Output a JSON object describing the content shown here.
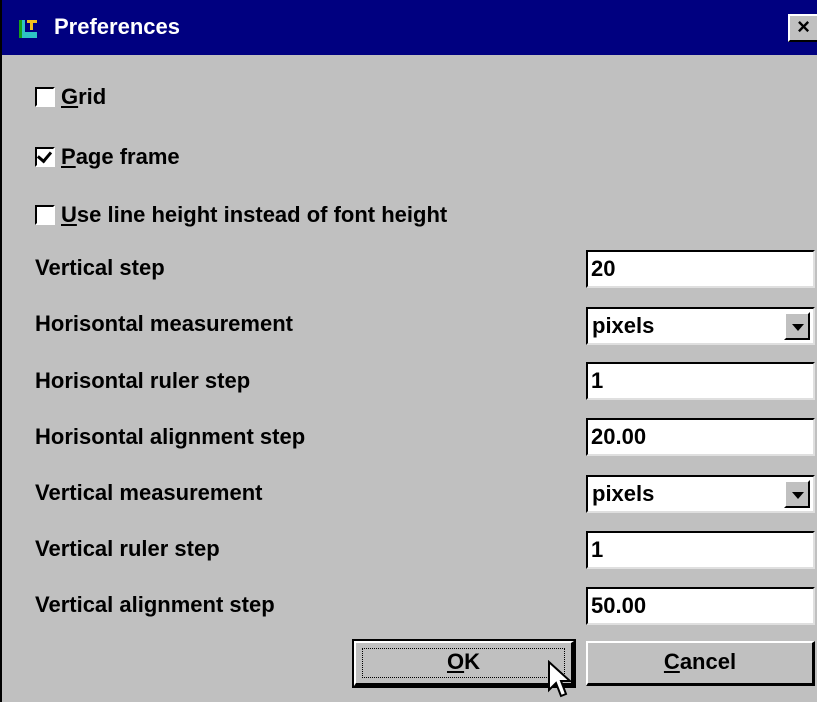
{
  "window": {
    "title": "Preferences",
    "close_glyph": "×",
    "icon": "app-logo-icon"
  },
  "checkboxes": [
    {
      "accel": "G",
      "rest": "rid",
      "checked": false
    },
    {
      "accel": "P",
      "rest": "age frame",
      "checked": true
    },
    {
      "accel": "U",
      "rest": "se line height instead of font height",
      "checked": false
    }
  ],
  "fields": {
    "vertical_step": {
      "label": "Vertical step",
      "value": "20"
    },
    "horisontal_measurement": {
      "label": "Horisontal measurement",
      "value": "pixels"
    },
    "horisontal_ruler_step": {
      "label": "Horisontal ruler step",
      "value": "1"
    },
    "horisontal_alignment_step": {
      "label": "Horisontal alignment step",
      "value": "20.00"
    },
    "vertical_measurement": {
      "label": "Vertical measurement",
      "value": "pixels"
    },
    "vertical_ruler_step": {
      "label": "Vertical ruler step",
      "value": "1"
    },
    "vertical_alignment_step": {
      "label": "Vertical alignment step",
      "value": "50.00"
    }
  },
  "buttons": {
    "ok": {
      "accel": "O",
      "rest": "K"
    },
    "cancel": {
      "accel": "C",
      "rest": "ancel"
    }
  }
}
